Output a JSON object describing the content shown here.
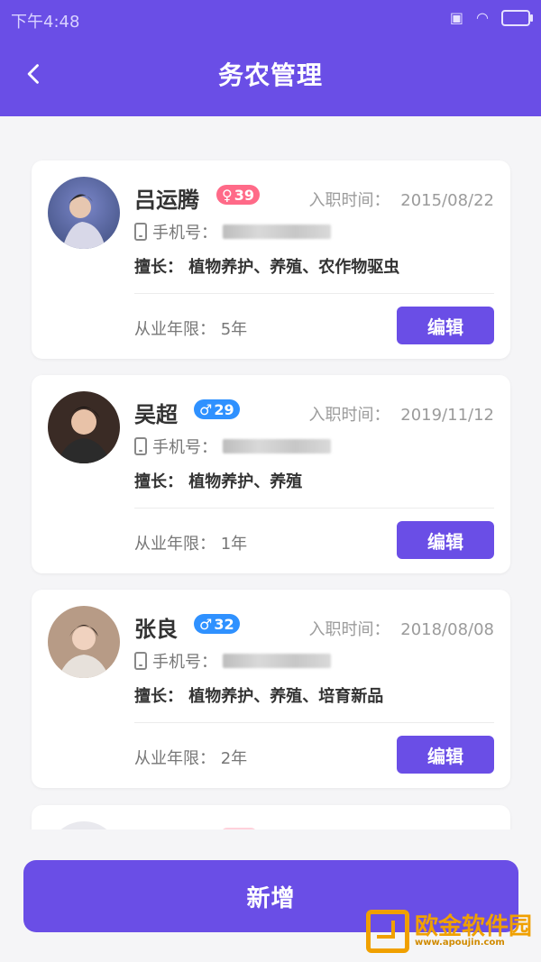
{
  "status_bar": {
    "time": "下午4:48"
  },
  "header": {
    "title": "务农管理"
  },
  "labels": {
    "join_label": "入职时间：",
    "phone_label": "手机号：",
    "skill_label": "擅长：",
    "years_label": "从业年限：",
    "edit": "编辑"
  },
  "workers": [
    {
      "name": "吕运腾",
      "gender": "female",
      "gender_symbol": "♀",
      "age": "39",
      "join_date": "2015/08/22",
      "skills": "植物养护、养殖、农作物驱虫",
      "years": "5年"
    },
    {
      "name": "吴超",
      "gender": "male",
      "gender_symbol": "♂",
      "age": "29",
      "join_date": "2019/11/12",
      "skills": "植物养护、养殖",
      "years": "1年"
    },
    {
      "name": "张良",
      "gender": "male",
      "gender_symbol": "♂",
      "age": "32",
      "join_date": "2018/08/08",
      "skills": "植物养护、养殖、培育新品",
      "years": "2年"
    }
  ],
  "footer": {
    "add_label": "新增"
  },
  "watermark": {
    "text": "欧金软件园",
    "url": "www.apoujin.com"
  },
  "colors": {
    "primary": "#6a4ee6",
    "female": "#ff6a88",
    "male": "#2f91ff"
  }
}
